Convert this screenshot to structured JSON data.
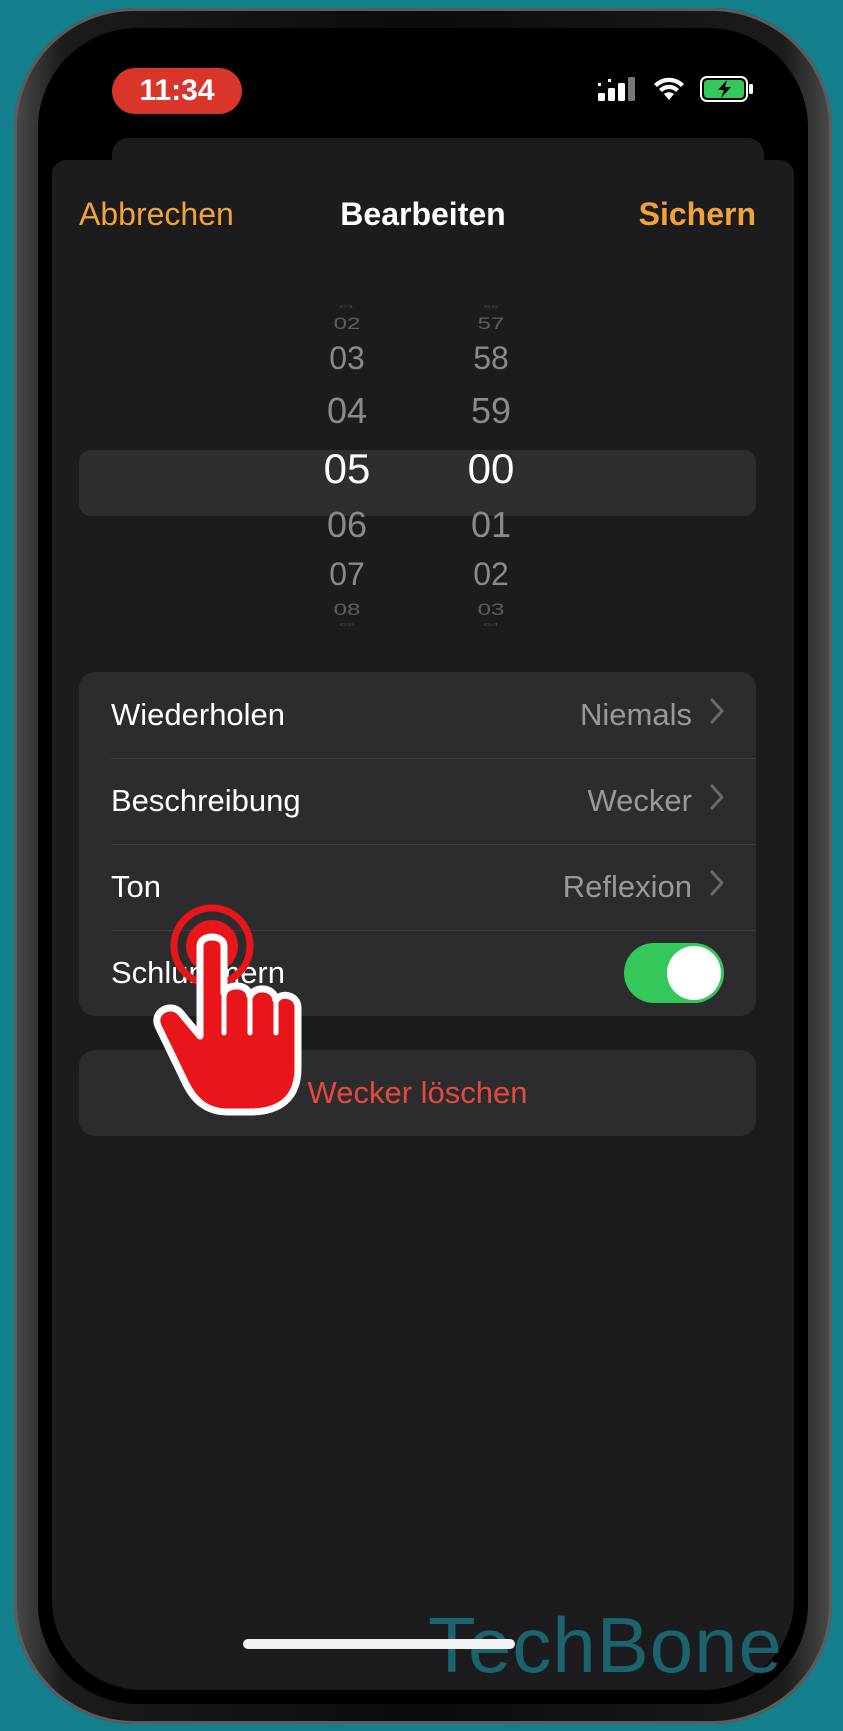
{
  "status_bar": {
    "time": "11:34"
  },
  "nav": {
    "cancel_label": "Abbrechen",
    "title": "Bearbeiten",
    "save_label": "Sichern"
  },
  "time_picker": {
    "hours": [
      "01",
      "02",
      "03",
      "04",
      "05",
      "06",
      "07",
      "08",
      "09"
    ],
    "minutes": [
      "56",
      "57",
      "58",
      "59",
      "00",
      "01",
      "02",
      "03",
      "04"
    ],
    "selected_hour": "05",
    "selected_minute": "00"
  },
  "settings": {
    "repeat": {
      "label": "Wiederholen",
      "value": "Niemals"
    },
    "description": {
      "label": "Beschreibung",
      "value": "Wecker"
    },
    "sound": {
      "label": "Ton",
      "value": "Reflexion"
    },
    "snooze": {
      "label": "Schlummern",
      "enabled": true
    }
  },
  "delete_label": "Wecker löschen",
  "watermark": "TechBone",
  "colors": {
    "accent": "#f1a33b",
    "destructive": "#e5493d",
    "toggle_on": "#34c759",
    "recording_pill": "#d9362b"
  }
}
